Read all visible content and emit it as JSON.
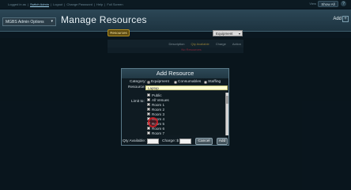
{
  "topbar": {
    "links": [
      "Logged in as",
      "Switch Admin",
      "Logout",
      "Change Password",
      "Help",
      "Full Screen"
    ],
    "view_label": "View",
    "show_all": "Show All",
    "help_icon": "?"
  },
  "header": {
    "admin_select": "MGBS Admin Options",
    "title": "Manage Resources",
    "add_label": "Add",
    "add_icon": "+"
  },
  "toolbar": {
    "resources_tab": "Resources",
    "type_select": "Equipment"
  },
  "list": {
    "columns": [
      "Description",
      "Qty Available",
      "Charge",
      "Action"
    ],
    "placeholder": "No Resources"
  },
  "dialog": {
    "title": "Add Resource",
    "category_label": "Category:",
    "categories": [
      {
        "label": "Equipment",
        "selected": true
      },
      {
        "label": "Consumables",
        "selected": false
      },
      {
        "label": "Staffing",
        "selected": false
      }
    ],
    "resource_label": "Resource:",
    "resource_value": "Laptop",
    "limit_label": "Limit to:",
    "venues": [
      {
        "label": "Public",
        "checked": false
      },
      {
        "label": "All Venues",
        "checked": false
      },
      {
        "label": "Room 1",
        "checked": true
      },
      {
        "label": "Room 2",
        "checked": true
      },
      {
        "label": "Room 3",
        "checked": true
      },
      {
        "label": "Room 4",
        "checked": true
      },
      {
        "label": "Room 5",
        "checked": true
      },
      {
        "label": "Room 6",
        "checked": false
      },
      {
        "label": "Room 7",
        "checked": false
      }
    ],
    "qty_label": "Qty Available:",
    "charge_label": "Charge: $",
    "cancel_label": "Cancel",
    "add_label": "Add"
  }
}
